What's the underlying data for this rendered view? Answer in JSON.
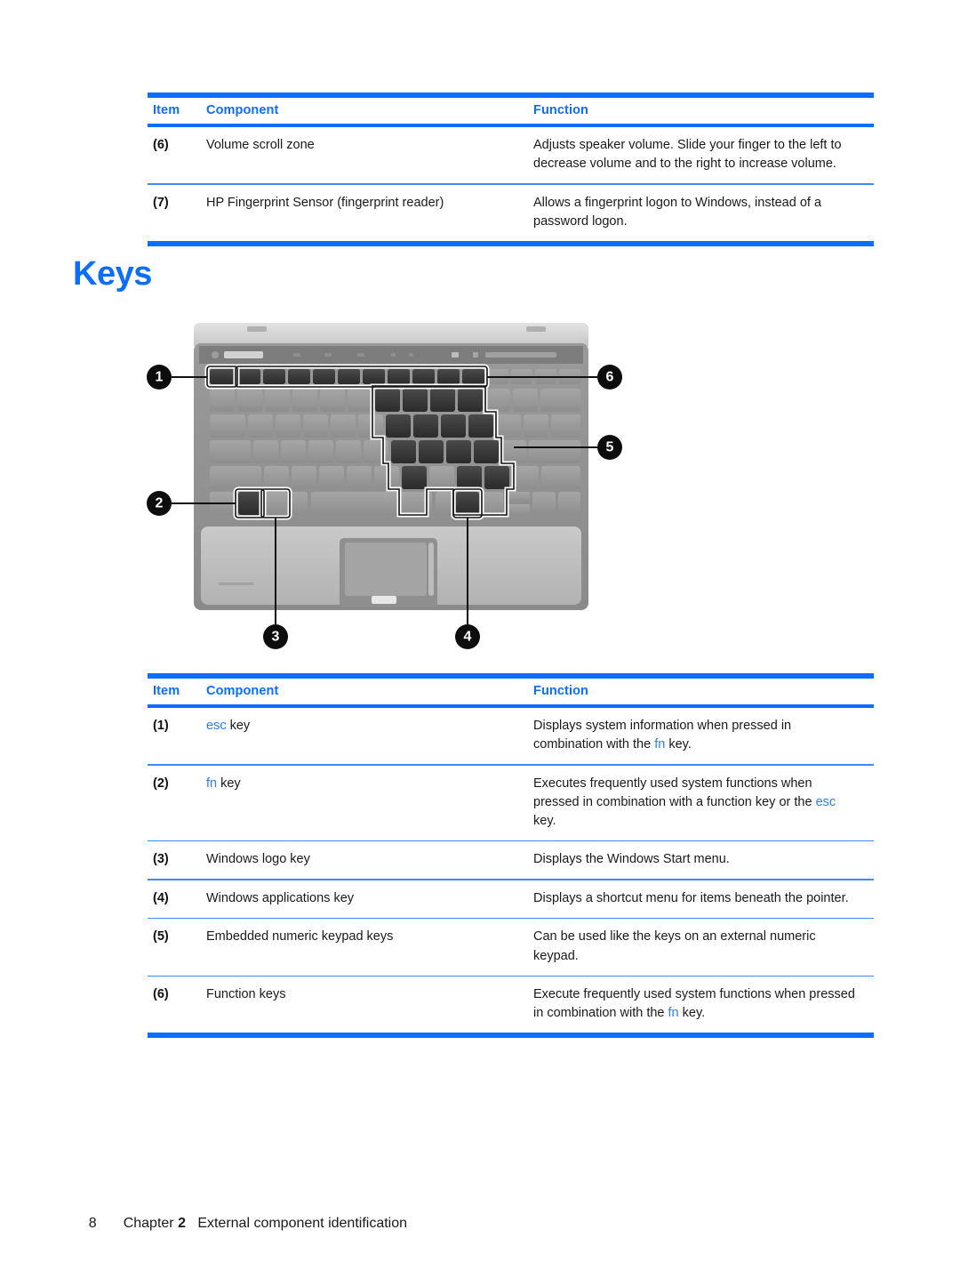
{
  "heading": {
    "title": "Keys"
  },
  "top_table": {
    "headers": {
      "item": "Item",
      "component": "Component",
      "function": "Function"
    },
    "rows": [
      {
        "item": "(6)",
        "component": "Volume scroll zone",
        "function": "Adjusts speaker volume. Slide your finger to the left to decrease volume and to the right to increase volume."
      },
      {
        "item": "(7)",
        "component": "HP Fingerprint Sensor (fingerprint reader)",
        "function": "Allows a fingerprint logon to Windows, instead of a password logon."
      }
    ]
  },
  "keys_table": {
    "headers": {
      "item": "Item",
      "component": "Component",
      "function": "Function"
    },
    "rows": [
      {
        "item": "(1)",
        "component_key": "esc",
        "component_rest": " key",
        "function_a": "Displays system information when pressed in combination with the ",
        "function_key": "fn",
        "function_b": " key."
      },
      {
        "item": "(2)",
        "component_key": "fn",
        "component_rest": " key",
        "function_a": "Executes frequently used system functions when pressed in combination with a function key or the ",
        "function_key": "esc",
        "function_b": " key."
      },
      {
        "item": "(3)",
        "component": "Windows logo key",
        "function": "Displays the Windows Start menu."
      },
      {
        "item": "(4)",
        "component": "Windows applications key",
        "function": "Displays a shortcut menu for items beneath the pointer."
      },
      {
        "item": "(5)",
        "component": "Embedded numeric keypad keys",
        "function": "Can be used like the keys on an external numeric keypad."
      },
      {
        "item": "(6)",
        "component": "Function keys",
        "function_a": "Execute frequently used system functions when pressed in combination with the ",
        "function_key": "fn",
        "function_b": " key."
      }
    ]
  },
  "illustration": {
    "alt": "Top view of notebook keyboard with numbered callouts",
    "callouts": [
      {
        "id": "1",
        "label": "1",
        "target": "esc key"
      },
      {
        "id": "2",
        "label": "2",
        "target": "fn key"
      },
      {
        "id": "3",
        "label": "3",
        "target": "Windows logo key"
      },
      {
        "id": "4",
        "label": "4",
        "target": "Windows applications key"
      },
      {
        "id": "5",
        "label": "5",
        "target": "Embedded numeric keypad keys"
      },
      {
        "id": "6",
        "label": "6",
        "target": "Function keys"
      }
    ]
  },
  "footer": {
    "page_number": "8",
    "chapter_word": "Chapter",
    "chapter_number": "2",
    "chapter_title": "External component identification"
  },
  "colors": {
    "accent_blue": "#0d6efd",
    "key_blue": "#2b7ef0",
    "text": "#1a1a1a"
  }
}
